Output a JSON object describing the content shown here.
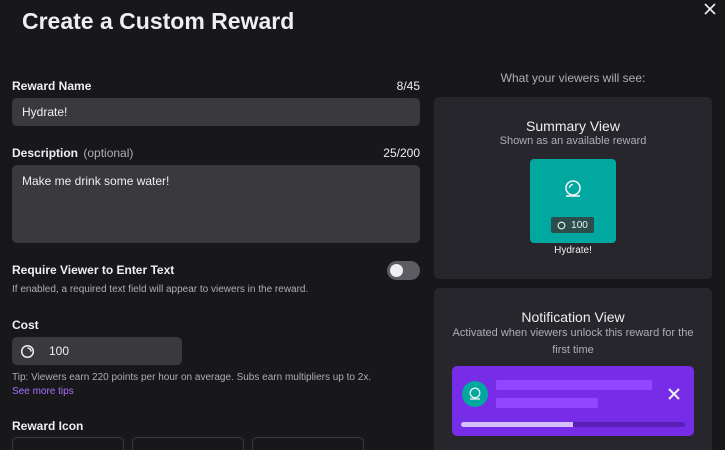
{
  "dialog": {
    "title": "Create a Custom Reward"
  },
  "form": {
    "name": {
      "label": "Reward Name",
      "counter": "8/45",
      "value": "Hydrate!"
    },
    "description": {
      "label": "Description",
      "optional": "(optional)",
      "counter": "25/200",
      "value": "Make me drink some water!"
    },
    "require_text": {
      "label": "Require Viewer to Enter Text",
      "help": "If enabled, a required text field will appear to viewers in the reward.",
      "enabled": false
    },
    "cost": {
      "label": "Cost",
      "value": "100",
      "tip": "Tip: Viewers earn 220 points per hour on average. Subs earn multipliers up to 2x.",
      "more_tips": "See more tips"
    },
    "icon": {
      "label": "Reward Icon"
    }
  },
  "preview": {
    "heading": "What your viewers will see:",
    "summary": {
      "title": "Summary View",
      "subtitle": "Shown as an available reward",
      "tile_cost": "100",
      "tile_name": "Hydrate!",
      "tile_color": "#00a8a0"
    },
    "notification": {
      "title": "Notification View",
      "subtitle": "Activated when viewers unlock this reward for the first time",
      "card_color": "#772ce8",
      "progress": 0.5
    }
  },
  "colors": {
    "background": "#18181b",
    "input": "#3a3a3d",
    "panel": "#26262c",
    "link": "#a970ff"
  },
  "icons": {
    "close": "close-icon",
    "channel_points": "channel-points-icon",
    "reward_glyph": "water-drop-icon"
  }
}
